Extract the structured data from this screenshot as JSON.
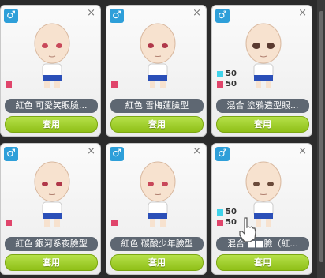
{
  "cards": [
    {
      "gender_icon": "♂",
      "name": "紅色 可愛笑眼臉...",
      "button": "套用",
      "stats": [
        {
          "color": "red",
          "value": ""
        }
      ]
    },
    {
      "gender_icon": "♂",
      "name": "紅色 雪梅蓮臉型",
      "button": "套用",
      "stats": [
        {
          "color": "red",
          "value": ""
        }
      ]
    },
    {
      "gender_icon": "♂",
      "name": "混合 塗鴉造型眼...",
      "button": "套用",
      "stats": [
        {
          "color": "cyan",
          "value": "50"
        },
        {
          "color": "red",
          "value": "50"
        }
      ]
    },
    {
      "gender_icon": "♂",
      "name": "紅色 銀河系夜臉型",
      "button": "套用",
      "stats": [
        {
          "color": "red",
          "value": ""
        }
      ]
    },
    {
      "gender_icon": "♂",
      "name": "紅色 碳酸少年臉型",
      "button": "套用",
      "stats": [
        {
          "color": "red",
          "value": ""
        }
      ]
    },
    {
      "gender_icon": "♂",
      "name": "混合 ■■臉（紅...",
      "button": "套用",
      "stats": [
        {
          "color": "cyan",
          "value": "50"
        },
        {
          "color": "red",
          "value": "50"
        }
      ]
    }
  ],
  "close_icon": "×",
  "colors": {
    "gender_badge": "#2e9fd9",
    "apply_button": "#9bca1f",
    "name_bar": "#5e6772",
    "red": "#e0456b",
    "cyan": "#3fd3ea"
  }
}
